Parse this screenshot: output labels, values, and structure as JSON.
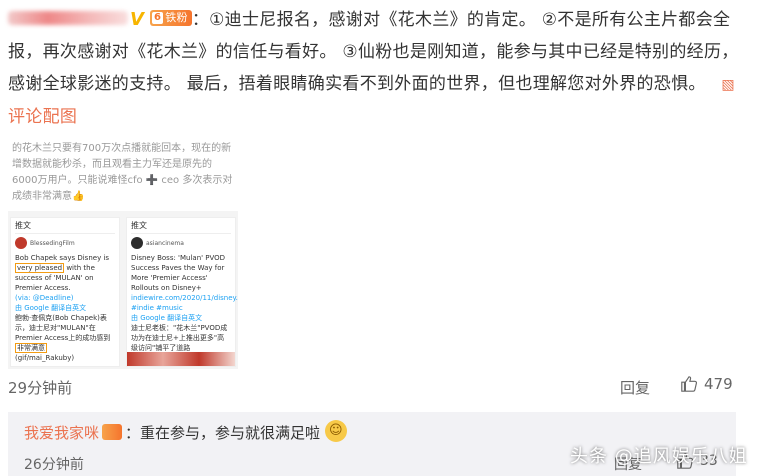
{
  "comment": {
    "fan_badge_level": "6",
    "fan_badge_label": "铁粉",
    "text": "：①迪士尼报名，感谢对《花木兰》的肯定。 ②不是所有公主片都会全报，再次感谢对《花木兰》的信任与看好。 ③仙粉也是刚知道，能参与其中已经是特别的经历，感谢全球影迷的支持。 最后，捂着眼睛确实看不到外面的世界，但也理解您对外界的恐惧。",
    "image_link_label": "评论配图",
    "time": "29分钟前",
    "reply_label": "回复",
    "like_count": "479"
  },
  "attachment": {
    "top_text": "的花木兰只要有700万次点播就能回本，现在的新增数据就能秒杀，而且观看主力军还是原先的6000万用户。只能说难怪cfo ➕ ceo 多次表示对成绩非常满意👍",
    "card_left": {
      "header": "推文",
      "name": "BlessedingFilm",
      "body_pre": "Bob Chapek says Disney is",
      "body_hl": "very pleased",
      "body_post": "with the success of 'MULAN' on Premier Access.",
      "via": "(via: @Deadline)",
      "translate": "由 Google 翻译自英文",
      "cn_pre": "鲍勃·查佩克(Bob Chapek)表示，迪士尼对\"MULAN\"在Premier Access上的成功感到",
      "cn_hl": "非常满意",
      "footer": "(gif/mai_Rakuby)"
    },
    "card_right": {
      "header": "推文",
      "name": "asiancinema",
      "body": "Disney Boss: 'Mulan' PVOD Success Paves the Way for More 'Premier Access' Rollouts on Disney+",
      "link": "indiewire.com/2020/11/disney... #indie #music",
      "translate": "由 Google 翻译自英文",
      "cn": "迪士尼老板：\"花木兰\"PVOD成功为在迪士尼+上推出更多\"高级访问\"铺平了道路"
    }
  },
  "sub_comment": {
    "author": "我爱我家咪",
    "text": "：重在参与，参与就很满足啦",
    "time": "26分钟前",
    "reply_label": "回复",
    "like_count": "33"
  },
  "watermark": "头条 @追风娱乐八姐",
  "colors": {
    "accent": "#eb7350",
    "badge": "#f5742d",
    "subbox_bg": "#f2f2f5"
  }
}
